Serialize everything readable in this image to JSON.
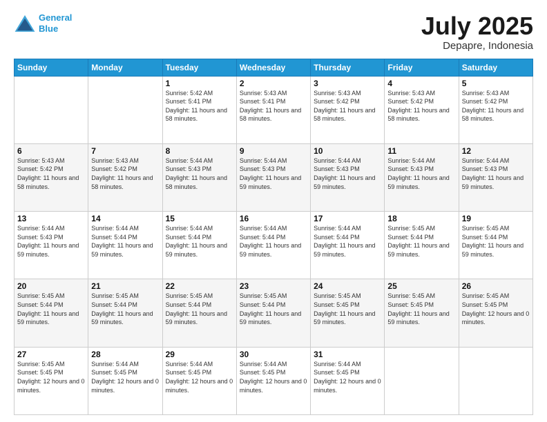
{
  "header": {
    "logo_line1": "General",
    "logo_line2": "Blue",
    "month": "July 2025",
    "location": "Depapre, Indonesia"
  },
  "days_of_week": [
    "Sunday",
    "Monday",
    "Tuesday",
    "Wednesday",
    "Thursday",
    "Friday",
    "Saturday"
  ],
  "weeks": [
    [
      {
        "day": "",
        "info": ""
      },
      {
        "day": "",
        "info": ""
      },
      {
        "day": "1",
        "sunrise": "5:42 AM",
        "sunset": "5:41 PM",
        "daylight": "11 hours and 58 minutes."
      },
      {
        "day": "2",
        "sunrise": "5:43 AM",
        "sunset": "5:41 PM",
        "daylight": "11 hours and 58 minutes."
      },
      {
        "day": "3",
        "sunrise": "5:43 AM",
        "sunset": "5:42 PM",
        "daylight": "11 hours and 58 minutes."
      },
      {
        "day": "4",
        "sunrise": "5:43 AM",
        "sunset": "5:42 PM",
        "daylight": "11 hours and 58 minutes."
      },
      {
        "day": "5",
        "sunrise": "5:43 AM",
        "sunset": "5:42 PM",
        "daylight": "11 hours and 58 minutes."
      }
    ],
    [
      {
        "day": "6",
        "sunrise": "5:43 AM",
        "sunset": "5:42 PM",
        "daylight": "11 hours and 58 minutes."
      },
      {
        "day": "7",
        "sunrise": "5:43 AM",
        "sunset": "5:42 PM",
        "daylight": "11 hours and 58 minutes."
      },
      {
        "day": "8",
        "sunrise": "5:44 AM",
        "sunset": "5:43 PM",
        "daylight": "11 hours and 58 minutes."
      },
      {
        "day": "9",
        "sunrise": "5:44 AM",
        "sunset": "5:43 PM",
        "daylight": "11 hours and 59 minutes."
      },
      {
        "day": "10",
        "sunrise": "5:44 AM",
        "sunset": "5:43 PM",
        "daylight": "11 hours and 59 minutes."
      },
      {
        "day": "11",
        "sunrise": "5:44 AM",
        "sunset": "5:43 PM",
        "daylight": "11 hours and 59 minutes."
      },
      {
        "day": "12",
        "sunrise": "5:44 AM",
        "sunset": "5:43 PM",
        "daylight": "11 hours and 59 minutes."
      }
    ],
    [
      {
        "day": "13",
        "sunrise": "5:44 AM",
        "sunset": "5:43 PM",
        "daylight": "11 hours and 59 minutes."
      },
      {
        "day": "14",
        "sunrise": "5:44 AM",
        "sunset": "5:44 PM",
        "daylight": "11 hours and 59 minutes."
      },
      {
        "day": "15",
        "sunrise": "5:44 AM",
        "sunset": "5:44 PM",
        "daylight": "11 hours and 59 minutes."
      },
      {
        "day": "16",
        "sunrise": "5:44 AM",
        "sunset": "5:44 PM",
        "daylight": "11 hours and 59 minutes."
      },
      {
        "day": "17",
        "sunrise": "5:44 AM",
        "sunset": "5:44 PM",
        "daylight": "11 hours and 59 minutes."
      },
      {
        "day": "18",
        "sunrise": "5:45 AM",
        "sunset": "5:44 PM",
        "daylight": "11 hours and 59 minutes."
      },
      {
        "day": "19",
        "sunrise": "5:45 AM",
        "sunset": "5:44 PM",
        "daylight": "11 hours and 59 minutes."
      }
    ],
    [
      {
        "day": "20",
        "sunrise": "5:45 AM",
        "sunset": "5:44 PM",
        "daylight": "11 hours and 59 minutes."
      },
      {
        "day": "21",
        "sunrise": "5:45 AM",
        "sunset": "5:44 PM",
        "daylight": "11 hours and 59 minutes."
      },
      {
        "day": "22",
        "sunrise": "5:45 AM",
        "sunset": "5:44 PM",
        "daylight": "11 hours and 59 minutes."
      },
      {
        "day": "23",
        "sunrise": "5:45 AM",
        "sunset": "5:44 PM",
        "daylight": "11 hours and 59 minutes."
      },
      {
        "day": "24",
        "sunrise": "5:45 AM",
        "sunset": "5:45 PM",
        "daylight": "11 hours and 59 minutes."
      },
      {
        "day": "25",
        "sunrise": "5:45 AM",
        "sunset": "5:45 PM",
        "daylight": "11 hours and 59 minutes."
      },
      {
        "day": "26",
        "sunrise": "5:45 AM",
        "sunset": "5:45 PM",
        "daylight": "12 hours and 0 minutes."
      }
    ],
    [
      {
        "day": "27",
        "sunrise": "5:45 AM",
        "sunset": "5:45 PM",
        "daylight": "12 hours and 0 minutes."
      },
      {
        "day": "28",
        "sunrise": "5:44 AM",
        "sunset": "5:45 PM",
        "daylight": "12 hours and 0 minutes."
      },
      {
        "day": "29",
        "sunrise": "5:44 AM",
        "sunset": "5:45 PM",
        "daylight": "12 hours and 0 minutes."
      },
      {
        "day": "30",
        "sunrise": "5:44 AM",
        "sunset": "5:45 PM",
        "daylight": "12 hours and 0 minutes."
      },
      {
        "day": "31",
        "sunrise": "5:44 AM",
        "sunset": "5:45 PM",
        "daylight": "12 hours and 0 minutes."
      },
      {
        "day": "",
        "info": ""
      },
      {
        "day": "",
        "info": ""
      }
    ]
  ]
}
